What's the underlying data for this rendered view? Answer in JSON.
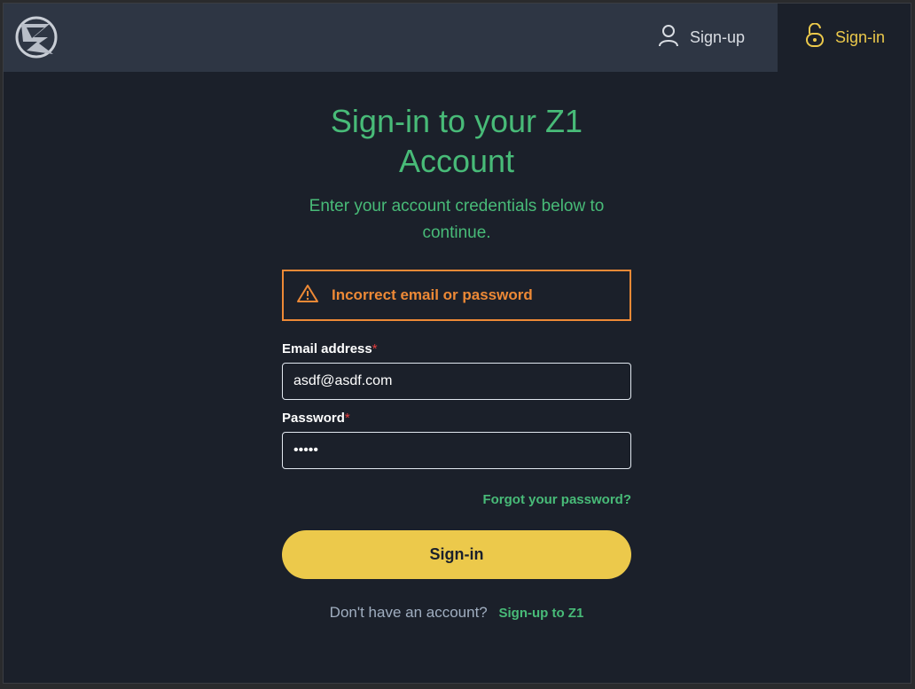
{
  "nav": {
    "signup_label": "Sign-up",
    "signin_label": "Sign-in",
    "active": "signin"
  },
  "page": {
    "title": "Sign-in to your Z1 Account",
    "subtitle": "Enter your account credentials below to continue."
  },
  "alert": {
    "message": "Incorrect email or password",
    "icon": "warning-icon",
    "color": "#ed8936"
  },
  "form": {
    "email_label": "Email address",
    "email_value": "asdf@asdf.com",
    "password_label": "Password",
    "password_value": "asdfa",
    "required_marker": "*",
    "forgot_link": "Forgot your password?",
    "submit_label": "Sign-in"
  },
  "footer": {
    "prompt": "Don't have an account?",
    "signup_link": "Sign-up to Z1"
  },
  "colors": {
    "background": "#1b202a",
    "header": "#2e3644",
    "accent_green": "#48bb78",
    "accent_yellow": "#ecc94b",
    "warning_orange": "#ed8936"
  }
}
